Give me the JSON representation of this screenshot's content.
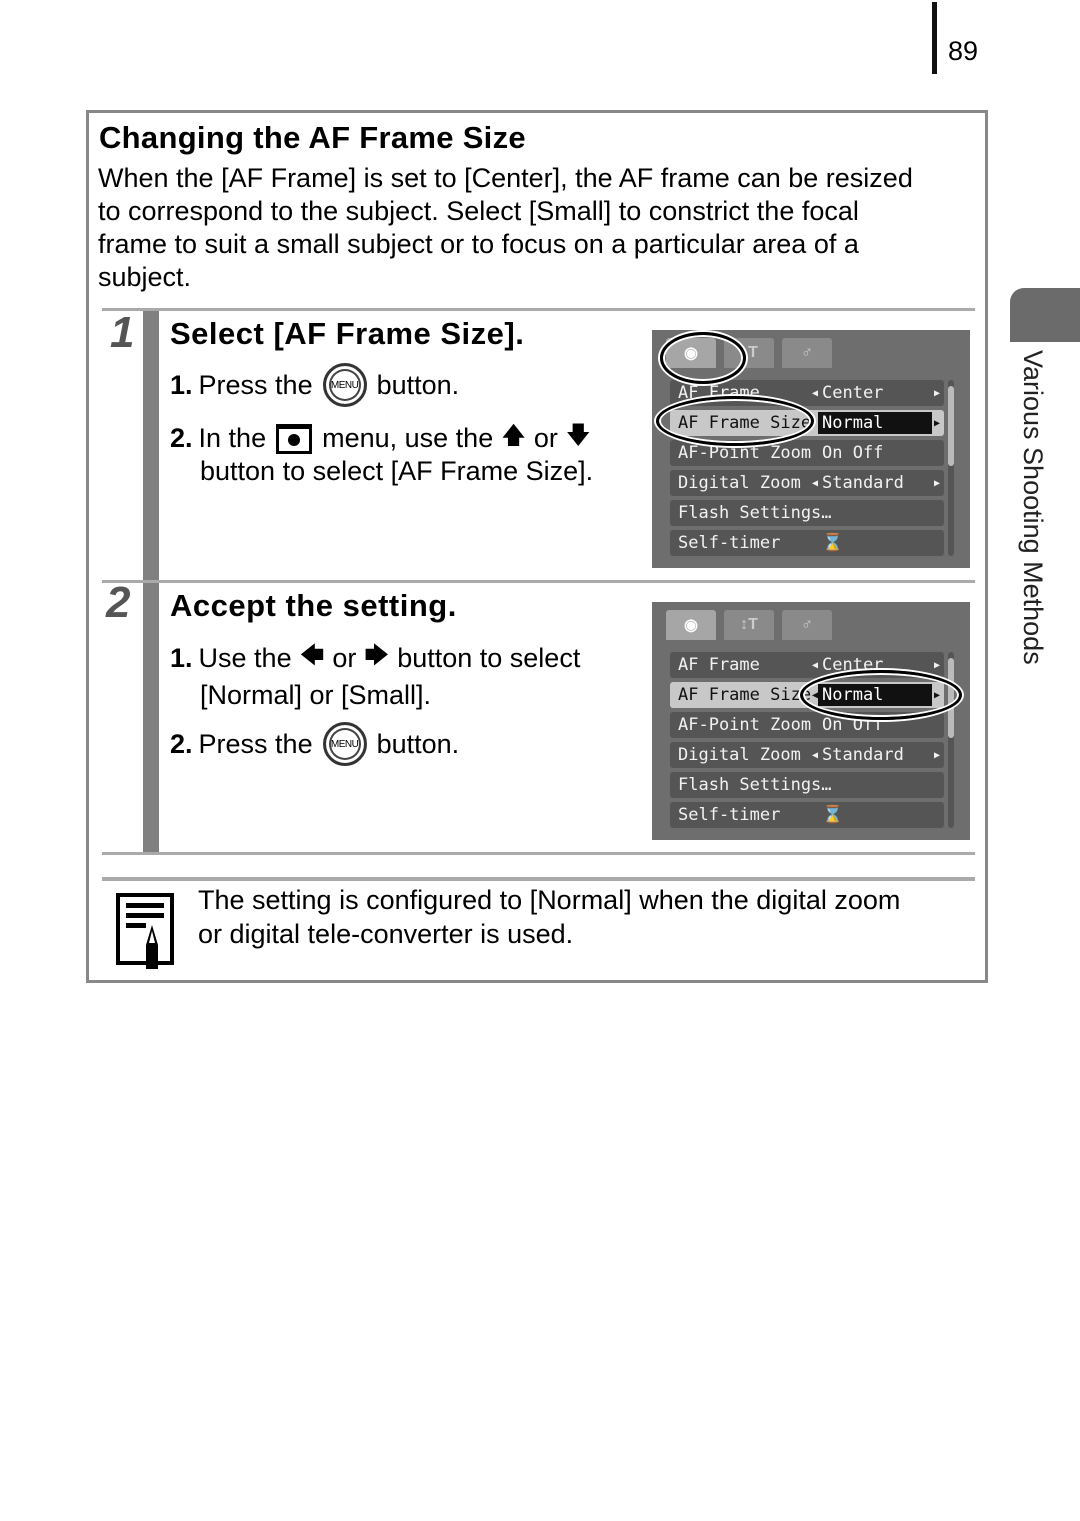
{
  "page_number": "89",
  "side_label": "Various Shooting Methods",
  "section": {
    "title": "Changing the AF Frame Size",
    "intro_lines": [
      "When the [AF Frame] is set to [Center], the AF frame can be resized",
      "to correspond to the subject. Select [Small] to constrict the focal",
      "frame to suit a small subject or to focus on a particular area of a",
      "subject."
    ]
  },
  "steps": [
    {
      "number": "1",
      "title": "Select [AF Frame Size].",
      "items": [
        {
          "num": "1.",
          "before": "Press the",
          "icon": "MENU",
          "after": "button."
        },
        {
          "num": "2.",
          "before": "In the",
          "mid1": "menu, use the",
          "or": "or",
          "line2": "button to select [AF Frame Size]."
        }
      ]
    },
    {
      "number": "2",
      "title": "Accept the setting.",
      "items": [
        {
          "num": "1.",
          "before": "Use the",
          "or": "or",
          "after": "button to select",
          "line2": "[Normal] or [Small]."
        },
        {
          "num": "2.",
          "before": "Press the",
          "icon": "MENU",
          "after": "button."
        }
      ]
    }
  ],
  "camera_menu": {
    "tabs": [
      "camera-icon",
      "tools-icon",
      "my-menu-icon"
    ],
    "rows": [
      {
        "label": "AF Frame",
        "value": "Center"
      },
      {
        "label": "AF Frame Size",
        "value": "Normal",
        "selected": true
      },
      {
        "label": "AF-Point Zoom",
        "value": "On  Off"
      },
      {
        "label": "Digital Zoom",
        "value": "Standard"
      },
      {
        "label": "Flash Settings…",
        "value": ""
      },
      {
        "label": "Self-timer",
        "value": "⌛"
      }
    ]
  },
  "note": {
    "lines": [
      "The setting is configured to [Normal] when the digital zoom",
      "or digital tele-converter is used."
    ]
  }
}
